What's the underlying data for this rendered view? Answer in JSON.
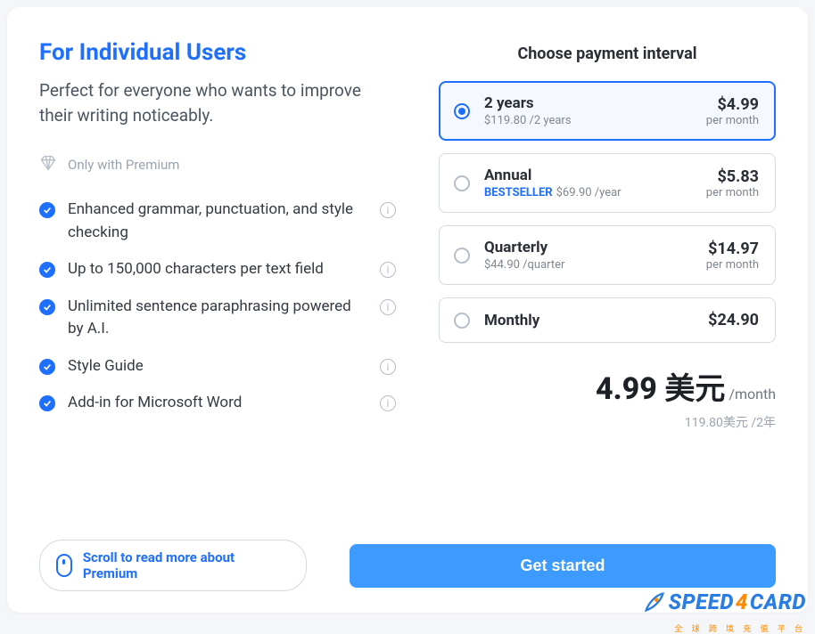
{
  "left": {
    "title": "For Individual Users",
    "subtitle": "Perfect for everyone who wants to improve their writing noticeably.",
    "premium_label": "Only with Premium",
    "features": [
      "Enhanced grammar, punctuation, and style checking",
      "Up to 150,000 characters per text field",
      "Unlimited sentence paraphrasing powered by A.I.",
      "Style Guide",
      "Add-in for Microsoft Word"
    ]
  },
  "payment": {
    "heading": "Choose payment interval",
    "plans": [
      {
        "name": "2 years",
        "sub": "$119.80 /2 years",
        "price": "$4.99",
        "per": "per month",
        "bestseller": false,
        "selected": true
      },
      {
        "name": "Annual",
        "sub": "$69.90 /year",
        "price": "$5.83",
        "per": "per month",
        "bestseller": true,
        "selected": false
      },
      {
        "name": "Quarterly",
        "sub": "$44.90 /quarter",
        "price": "$14.97",
        "per": "per month",
        "bestseller": false,
        "selected": false
      },
      {
        "name": "Monthly",
        "sub": "",
        "price": "$24.90",
        "per": "",
        "bestseller": false,
        "selected": false
      }
    ],
    "bestseller_label": "BESTSELLER",
    "summary_price": "4.99 美元",
    "summary_unit": "/month",
    "summary_sub": "119.80美元 /2年"
  },
  "footer": {
    "scroll_label": "Scroll to read more about Premium",
    "cta_label": "Get started"
  },
  "watermark": {
    "part1": "SPEED",
    "part2": "4",
    "part3": "CARD",
    "sub": "全 球 跨 境 充 值 平 台"
  }
}
